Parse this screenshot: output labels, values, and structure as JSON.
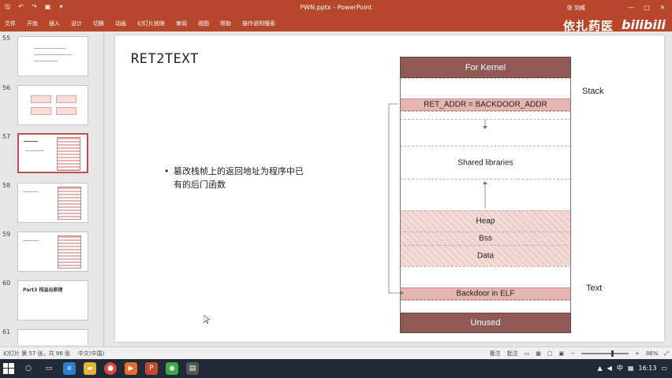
{
  "titlebar": {
    "title": "PWN.pptx  -  PowerPoint",
    "user": "张 剑威",
    "qa_icons": [
      "save-icon",
      "undo-icon",
      "redo-icon",
      "present-icon",
      "dropdown-icon"
    ],
    "win_buttons": [
      "—",
      "□",
      "✕"
    ]
  },
  "ribbon": {
    "tabs": [
      "文件",
      "开始",
      "插入",
      "设计",
      "切换",
      "动画",
      "幻灯片放映",
      "审阅",
      "视图",
      "帮助",
      "操作说明搜索"
    ]
  },
  "watermark": {
    "text": "依扎药医",
    "logo": "bilibili"
  },
  "thumbnails": [
    {
      "num": "55",
      "star": ""
    },
    {
      "num": "56",
      "star": ""
    },
    {
      "num": "57",
      "star": ""
    },
    {
      "num": "58",
      "star": ""
    },
    {
      "num": "59",
      "star": ""
    },
    {
      "num": "60",
      "star": "",
      "title": "Part3  栈溢出原理"
    },
    {
      "num": "61",
      "star": ""
    }
  ],
  "slide": {
    "title": "RET2TEXT",
    "bullet": "篡改栈帧上的返回地址为程序中已有的后门函数",
    "memory": {
      "kernel": "For Kernel",
      "ret_addr": "RET_ADDR = BACKDOOR_ADDR",
      "shared": "Shared libraries",
      "heap": "Heap",
      "bss": "Bss",
      "data": "Data",
      "backdoor": "Backdoor in ELF",
      "unused": "Unused",
      "stack_label": "Stack",
      "text_label": "Text"
    }
  },
  "statusbar": {
    "slide_info": "幻灯片 第 57 张，共 96 张",
    "lang": "中文(中国)",
    "notes": "备注",
    "comments": "批注",
    "zoom": "86%"
  },
  "taskbar": {
    "time": "16:13",
    "ime": "中"
  }
}
